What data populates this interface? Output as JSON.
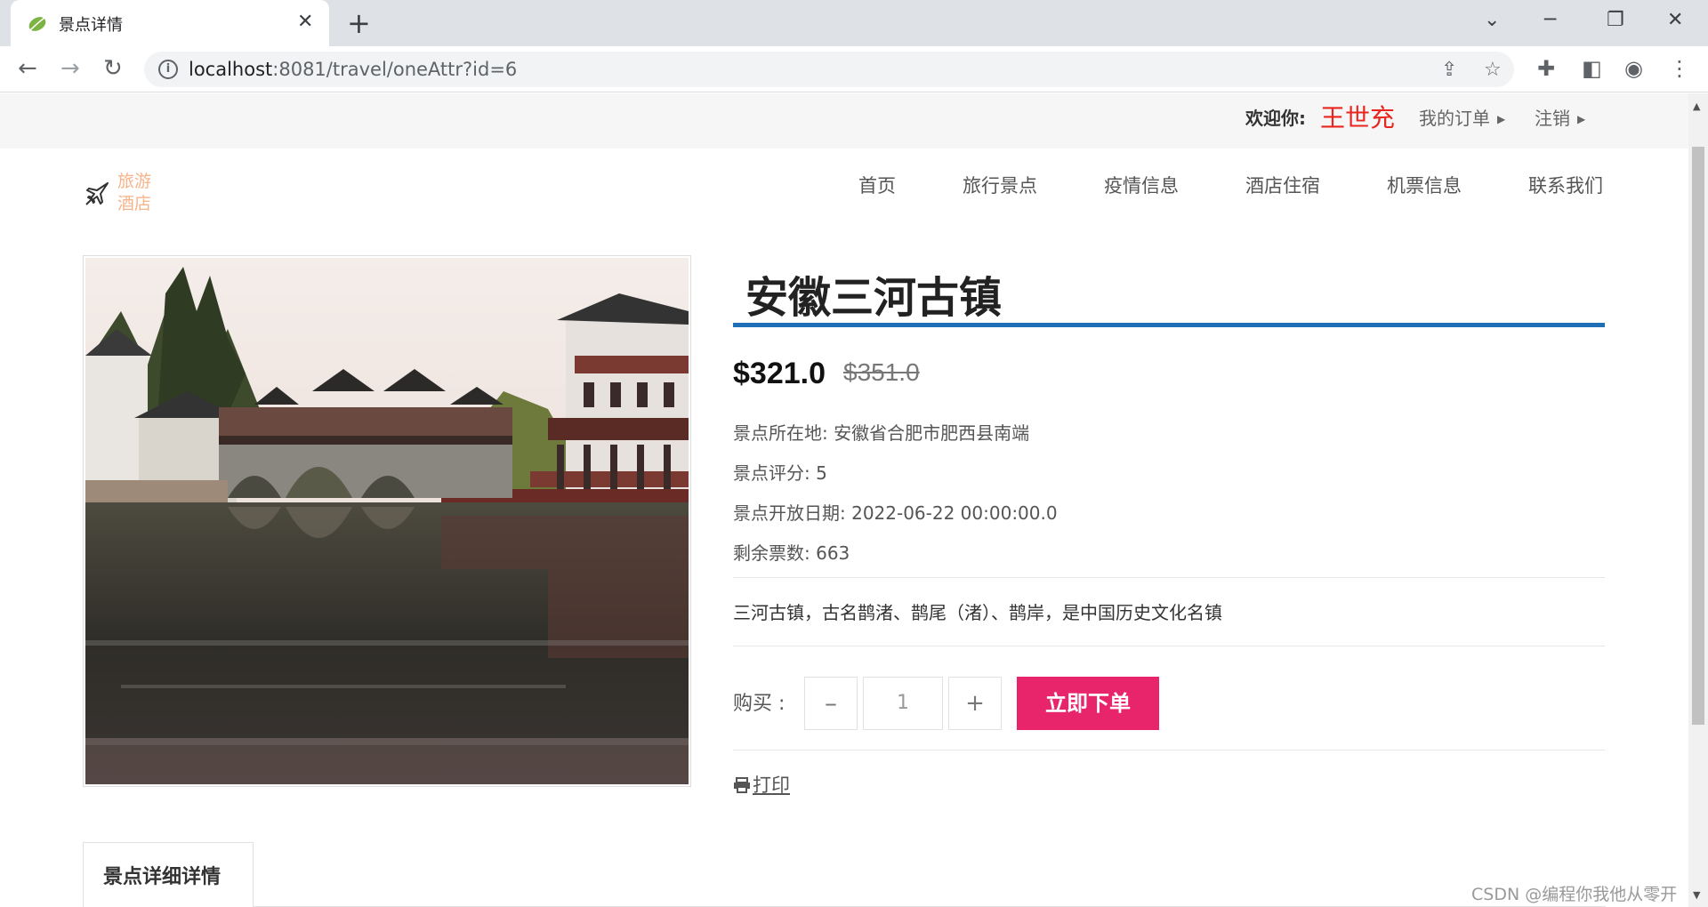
{
  "browser": {
    "tab_title": "景点详情",
    "url_host": "localhost",
    "url_path": ":8081/travel/oneAttr?id=6"
  },
  "topbar": {
    "welcome_label": "欢迎你:",
    "username": "王世充",
    "orders_link": "我的订单",
    "logout_link": "注销"
  },
  "logo": {
    "line1": "旅游",
    "line2": "酒店"
  },
  "nav": [
    "首页",
    "旅行景点",
    "疫情信息",
    "酒店住宿",
    "机票信息",
    "联系我们"
  ],
  "attraction": {
    "name": "安徽三河古镇",
    "price": "$321.0",
    "original_price": "$351.0",
    "location": "景点所在地: 安徽省合肥市肥西县南端",
    "rating": "景点评分: 5",
    "open_date": "景点开放日期: 2022-06-22 00:00:00.0",
    "tickets_left": "剩余票数: 663",
    "description": "三河古镇，古名鹊渚、鹊尾（渚）、鹊岸，是中国历史文化名镇"
  },
  "purchase": {
    "label": "购买 :",
    "minus": "–",
    "quantity": "1",
    "plus": "+",
    "order_button": "立即下单",
    "print_link": "打印"
  },
  "details_tab": "景点详细详情",
  "watermark": "CSDN @编程你我他从零开始",
  "colors": {
    "accent_blue": "#1f6fb7",
    "order_button": "#e8256b",
    "username": "#e8261f",
    "logo_text": "#f7b48a"
  }
}
